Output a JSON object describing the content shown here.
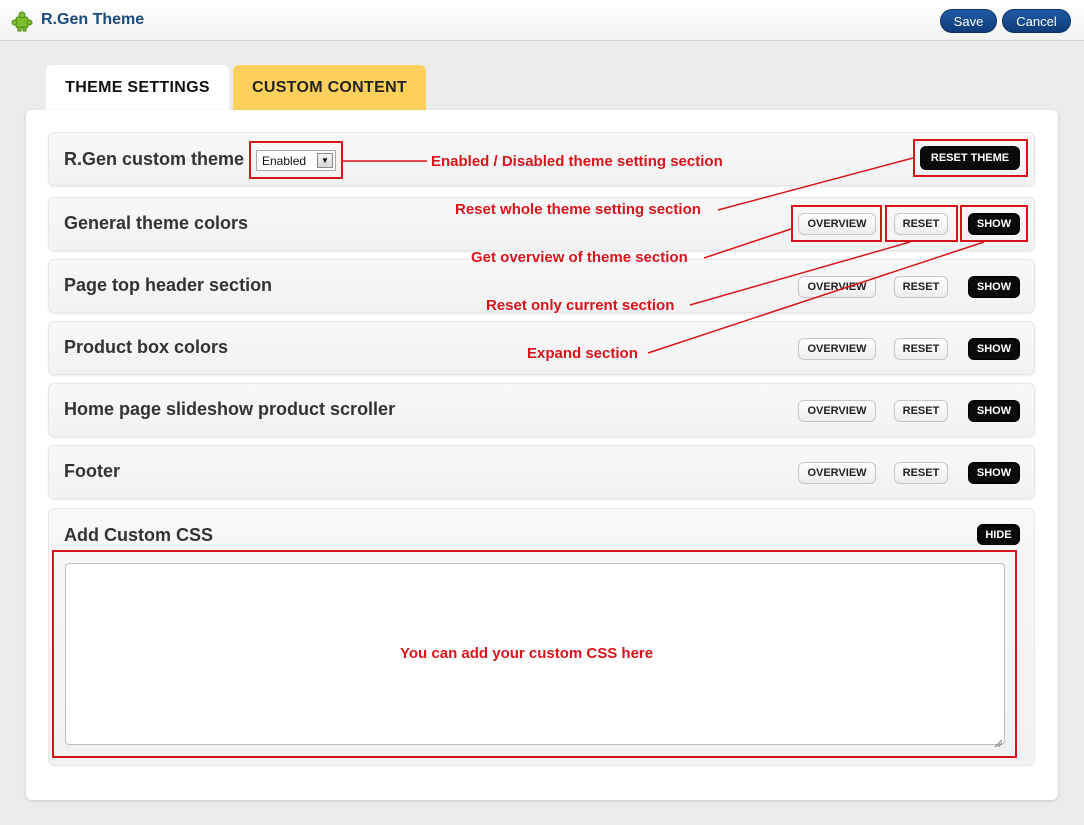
{
  "app": {
    "title": "R.Gen Theme",
    "icon": "puzzle-icon"
  },
  "toolbar": {
    "save_label": "Save",
    "cancel_label": "Cancel"
  },
  "tabs": [
    {
      "label": "THEME SETTINGS",
      "active": true
    },
    {
      "label": "CUSTOM CONTENT",
      "active": false
    }
  ],
  "theme_toggle": {
    "label": "R.Gen custom theme",
    "select_value": "Enabled",
    "reset_label": "RESET THEME"
  },
  "sections": [
    {
      "title": "General theme colors",
      "overview_label": "OVERVIEW",
      "reset_label": "RESET",
      "toggle_label": "SHOW"
    },
    {
      "title": "Page top header section",
      "overview_label": "OVERVIEW",
      "reset_label": "RESET",
      "toggle_label": "SHOW"
    },
    {
      "title": "Product box colors",
      "overview_label": "OVERVIEW",
      "reset_label": "RESET",
      "toggle_label": "SHOW"
    },
    {
      "title": "Home page slideshow product scroller",
      "overview_label": "OVERVIEW",
      "reset_label": "RESET",
      "toggle_label": "SHOW"
    },
    {
      "title": "Footer",
      "overview_label": "OVERVIEW",
      "reset_label": "RESET",
      "toggle_label": "SHOW"
    }
  ],
  "custom_css": {
    "title": "Add Custom CSS",
    "toggle_label": "HIDE"
  },
  "annotations": {
    "enabled_disabled": "Enabled / Disabled theme setting section",
    "reset_whole": "Reset whole theme setting section",
    "overview": "Get overview of theme section",
    "reset_current": "Reset only current section",
    "expand": "Expand section",
    "custom_css": "You can add your custom CSS here"
  },
  "colors": {
    "accent_blue": "#1c4a7d",
    "annotation_red": "#d8141b",
    "tab_highlight": "#ffd05c"
  }
}
